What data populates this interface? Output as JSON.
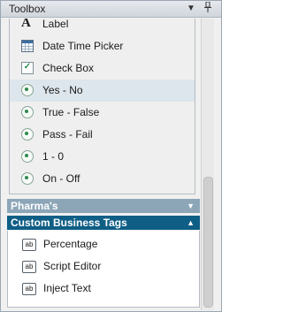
{
  "window": {
    "title": "Toolbox",
    "dropdown_glyph": "▼",
    "pin_glyph": "📌"
  },
  "group": {
    "items": [
      {
        "label": "Label",
        "icon": "label-icon"
      },
      {
        "label": "Date Time Picker",
        "icon": "datetime-picker-icon"
      },
      {
        "label": "Check Box",
        "icon": "checkbox-icon"
      },
      {
        "label": "Yes - No",
        "icon": "radio-icon",
        "selected": true
      },
      {
        "label": "True - False",
        "icon": "radio-icon"
      },
      {
        "label": "Pass - Fail",
        "icon": "radio-icon"
      },
      {
        "label": "1 - 0",
        "icon": "radio-icon"
      },
      {
        "label": "On - Off",
        "icon": "radio-icon"
      }
    ]
  },
  "sections": {
    "pharma": {
      "label": "Pharma's",
      "arrow": "▼"
    },
    "custom": {
      "label": "Custom Business Tags",
      "arrow": "▲"
    }
  },
  "custom_items": [
    {
      "label": "Percentage",
      "icon_text": "ab"
    },
    {
      "label": "Script Editor",
      "icon_text": "ab"
    },
    {
      "label": "Inject Text",
      "icon_text": "ab"
    }
  ],
  "colors": {
    "section_collapsed": "#8ca6b8",
    "section_expanded": "#0f5e86",
    "selected_row": "#dde6ec"
  }
}
